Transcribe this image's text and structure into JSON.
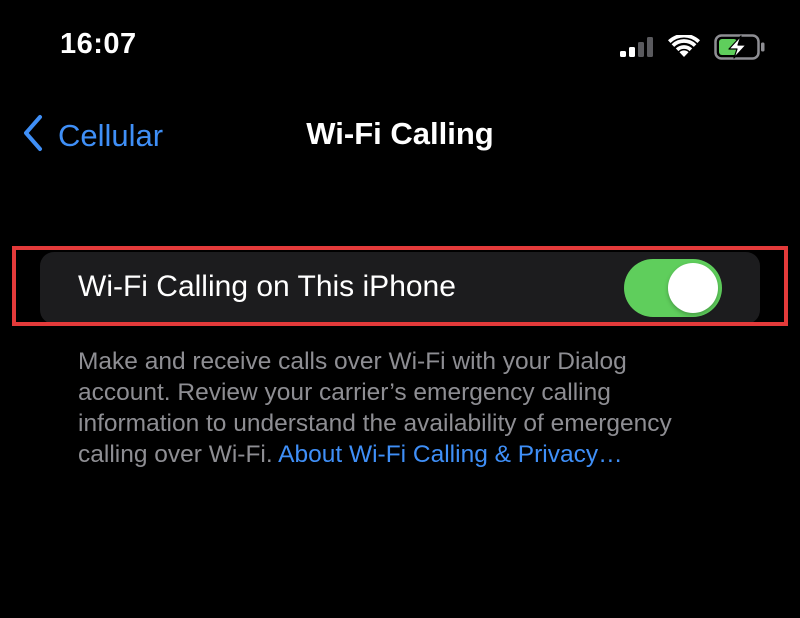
{
  "status_bar": {
    "time": "16:07",
    "icons": [
      "cellular-signal-icon",
      "wifi-icon",
      "battery-charging-icon"
    ]
  },
  "nav": {
    "back_label": "Cellular",
    "title": "Wi-Fi Calling"
  },
  "settings": {
    "wifi_calling_label": "Wi-Fi Calling on This iPhone",
    "wifi_calling_enabled": true
  },
  "footer": {
    "line1": "Make and receive calls over Wi-Fi with your Dialog",
    "line2": "account. Review your carrier’s emergency calling",
    "line3": "information to understand the availability of emergency",
    "line4_text": "calling over Wi-Fi. ",
    "link": "About Wi-Fi Calling & Privacy…"
  },
  "colors": {
    "background": "#000000",
    "cell_background": "#1c1c1e",
    "accent_blue": "#3f8ff7",
    "toggle_on": "#5fce5c",
    "highlight_red": "#e33a3a",
    "secondary_text": "#8e8e93"
  }
}
